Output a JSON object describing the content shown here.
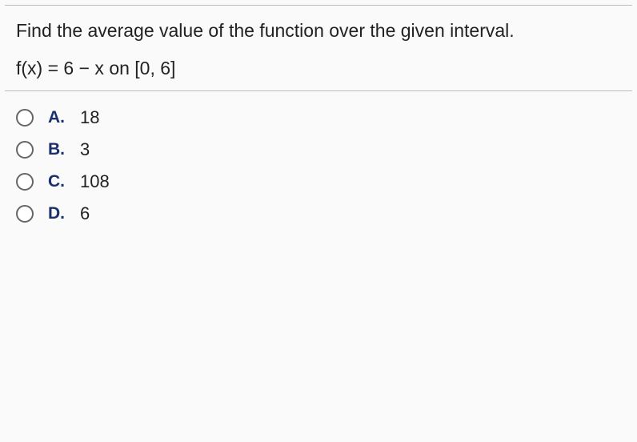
{
  "question": {
    "prompt": "Find the average value of the function over the given interval.",
    "equation": "f(x) = 6 − x on [0, 6]"
  },
  "options": [
    {
      "letter": "A.",
      "value": "18"
    },
    {
      "letter": "B.",
      "value": "3"
    },
    {
      "letter": "C.",
      "value": "108"
    },
    {
      "letter": "D.",
      "value": "6"
    }
  ]
}
